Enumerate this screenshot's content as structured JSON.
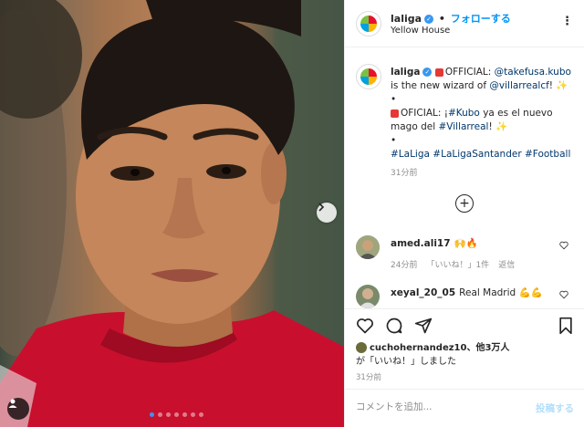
{
  "header": {
    "username": "laliga",
    "separator": "•",
    "follow_label": "フォローする",
    "location": "Yellow House",
    "more_icon": "more-horizontal-icon"
  },
  "avatar_logo_text": "LaLiga",
  "caption": {
    "username": "laliga",
    "line1_text": "OFFICIAL: ",
    "line1_mention": "@takefusa.kubo",
    "line2_text": "is the new wizard of ",
    "line2_mention": "@villarrealcf",
    "line2_end": "!",
    "bullet1": "•",
    "line3_text": "OFICIAL: ¡",
    "line3_tag": "#Kubo",
    "line3_end": " ya es el nuevo",
    "line4_text": "mago del ",
    "line4_tag": "#Villarreal",
    "line4_end": "!",
    "bullet2": "•",
    "hashtags": [
      "#LaLiga",
      "#LaLigaSantander",
      "#Football"
    ],
    "sparkle": "✨",
    "timestamp": "31分前"
  },
  "comments": [
    {
      "username": "amed.ali17",
      "text": "🙌🔥",
      "meta_time": "24分前",
      "meta_likes": "「いいね！」1件",
      "meta_reply": "返信"
    },
    {
      "username": "xeyal_20_05",
      "text": "Real Madrid 💪💪"
    }
  ],
  "likes": {
    "username": "cuchohernandez10",
    "rest": "、他3万人",
    "line2": "が「いいね！」しました"
  },
  "post_timestamp": "31分前",
  "comment_box": {
    "placeholder": "コメントを追加...",
    "post_label": "投稿する"
  },
  "colors": {
    "accent": "#0095f6",
    "link": "#00376b",
    "muted": "#8e8e8e",
    "carousel_active": "#3897f0"
  },
  "carousel": {
    "total": 7,
    "active_index": 0
  }
}
